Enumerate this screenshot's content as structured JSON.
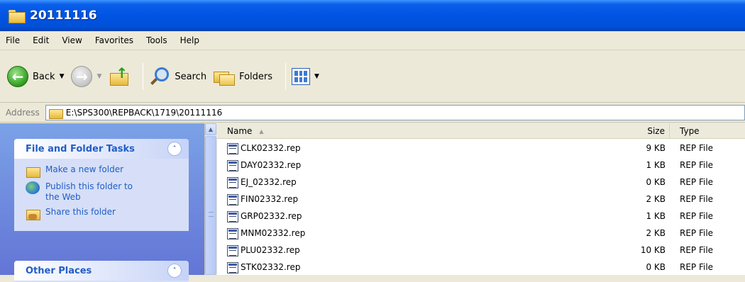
{
  "window": {
    "title": "20111116"
  },
  "menu": [
    "File",
    "Edit",
    "View",
    "Favorites",
    "Tools",
    "Help"
  ],
  "toolbar": {
    "back_label": "Back",
    "search_label": "Search",
    "folders_label": "Folders"
  },
  "address": {
    "label": "Address",
    "path": "E:\\SPS300\\REPBACK\\1719\\20111116"
  },
  "sidebar": {
    "panels": [
      {
        "title": "File and Folder Tasks",
        "tasks": [
          {
            "label": "Make a new folder",
            "icon": "new-folder-icon"
          },
          {
            "label": "Publish this folder to the Web",
            "icon": "publish-web-icon"
          },
          {
            "label": "Share this folder",
            "icon": "share-folder-icon"
          }
        ]
      },
      {
        "title": "Other Places"
      }
    ]
  },
  "columns": {
    "name": "Name",
    "size": "Size",
    "type": "Type"
  },
  "files": [
    {
      "name": "CLK02332.rep",
      "size": "9 KB",
      "type": "REP File"
    },
    {
      "name": "DAY02332.rep",
      "size": "1 KB",
      "type": "REP File"
    },
    {
      "name": "EJ_02332.rep",
      "size": "0 KB",
      "type": "REP File"
    },
    {
      "name": "FIN02332.rep",
      "size": "2 KB",
      "type": "REP File"
    },
    {
      "name": "GRP02332.rep",
      "size": "1 KB",
      "type": "REP File"
    },
    {
      "name": "MNM02332.rep",
      "size": "2 KB",
      "type": "REP File"
    },
    {
      "name": "PLU02332.rep",
      "size": "10 KB",
      "type": "REP File"
    },
    {
      "name": "STK02332.rep",
      "size": "0 KB",
      "type": "REP File"
    }
  ]
}
